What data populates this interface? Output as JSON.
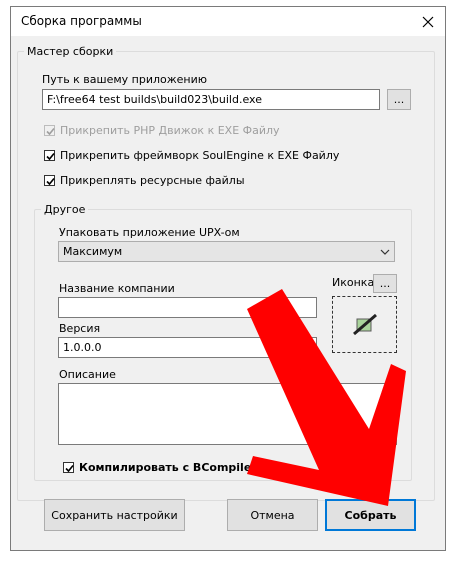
{
  "window": {
    "title": "Сборка программы"
  },
  "wizard": {
    "group_label": "Мастер сборки",
    "path_label": "Путь к вашему приложению",
    "path_value": "F:\\free64 test builds\\build023\\build.exe",
    "browse_label": "...",
    "check_php": {
      "label": "Прикрепить PHP Движок к EXE Файлу",
      "checked": true,
      "enabled": false
    },
    "check_framework": {
      "label": "Прикрепить фреймворк SoulEngine к EXE Файлу",
      "checked": true
    },
    "check_resources": {
      "label": "Прикреплять ресурсные файлы",
      "checked": true
    }
  },
  "other": {
    "group_label": "Другое",
    "upx_label": "Упаковать приложение UPX-ом",
    "upx_value": "Максимум",
    "company_label": "Название компании",
    "company_value": "",
    "version_label": "Версия",
    "version_value": "1.0.0.0",
    "icon_label": "Иконка",
    "icon_browse_label": "...",
    "description_label": "Описание",
    "description_value": "",
    "compile_check": {
      "label": "Компилировать с BCompiler'ом",
      "checked": true
    }
  },
  "footer": {
    "save_label": "Сохранить настройки",
    "cancel_label": "Отмена",
    "build_label": "Собрать"
  },
  "colors": {
    "arrow": "#ff0000",
    "focus": "#0078d7",
    "window_bg": "#f0f0f0"
  }
}
